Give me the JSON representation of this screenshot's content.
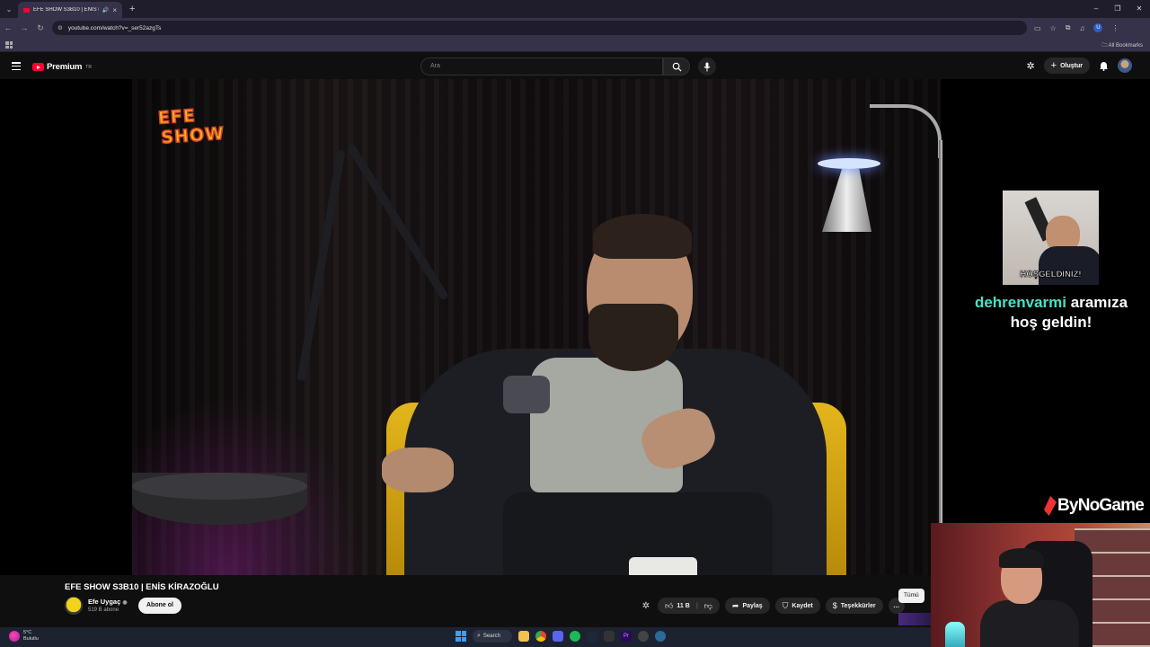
{
  "browser": {
    "tab_title": "EFE SHOW S3B10 | ENİS Kİ",
    "url": "youtube.com/watch?v=_ser52azgTs",
    "all_bookmarks": "All Bookmarks",
    "profile_initial": "U"
  },
  "yt_header": {
    "brand": "Premium",
    "region": "TR",
    "search_placeholder": "Ara",
    "create_label": "Oluştur"
  },
  "video": {
    "logo_line1": "EFE",
    "logo_line2": "SHOW",
    "gif_caption": "HOŞGELDİNİZ!",
    "welcome_user": "dehrenvarmi",
    "welcome_text1": "aramıza",
    "welcome_text2": "hoş geldin!",
    "sponsor": "ByNoGame"
  },
  "below": {
    "title": "EFE SHOW S3B10 | ENİS KİRAZOĞLU",
    "channel_name": "Efe Uygaç",
    "verified": "◉",
    "subscribers": "519 B abone",
    "subscribe_label": "Abone ol",
    "like_count": "11 B",
    "share_label": "Paylaş",
    "save_label": "Kaydet",
    "thanks_label": "Teşekkürler",
    "more": "…",
    "filter_all": "Tümü"
  },
  "taskbar": {
    "temp": "5°C",
    "weather": "Bulutlu",
    "search": "Search"
  },
  "colors": {
    "yt_red": "#ff0033",
    "welcome_user": "#46e3c2",
    "chair_yellow": "#e3b51c"
  }
}
